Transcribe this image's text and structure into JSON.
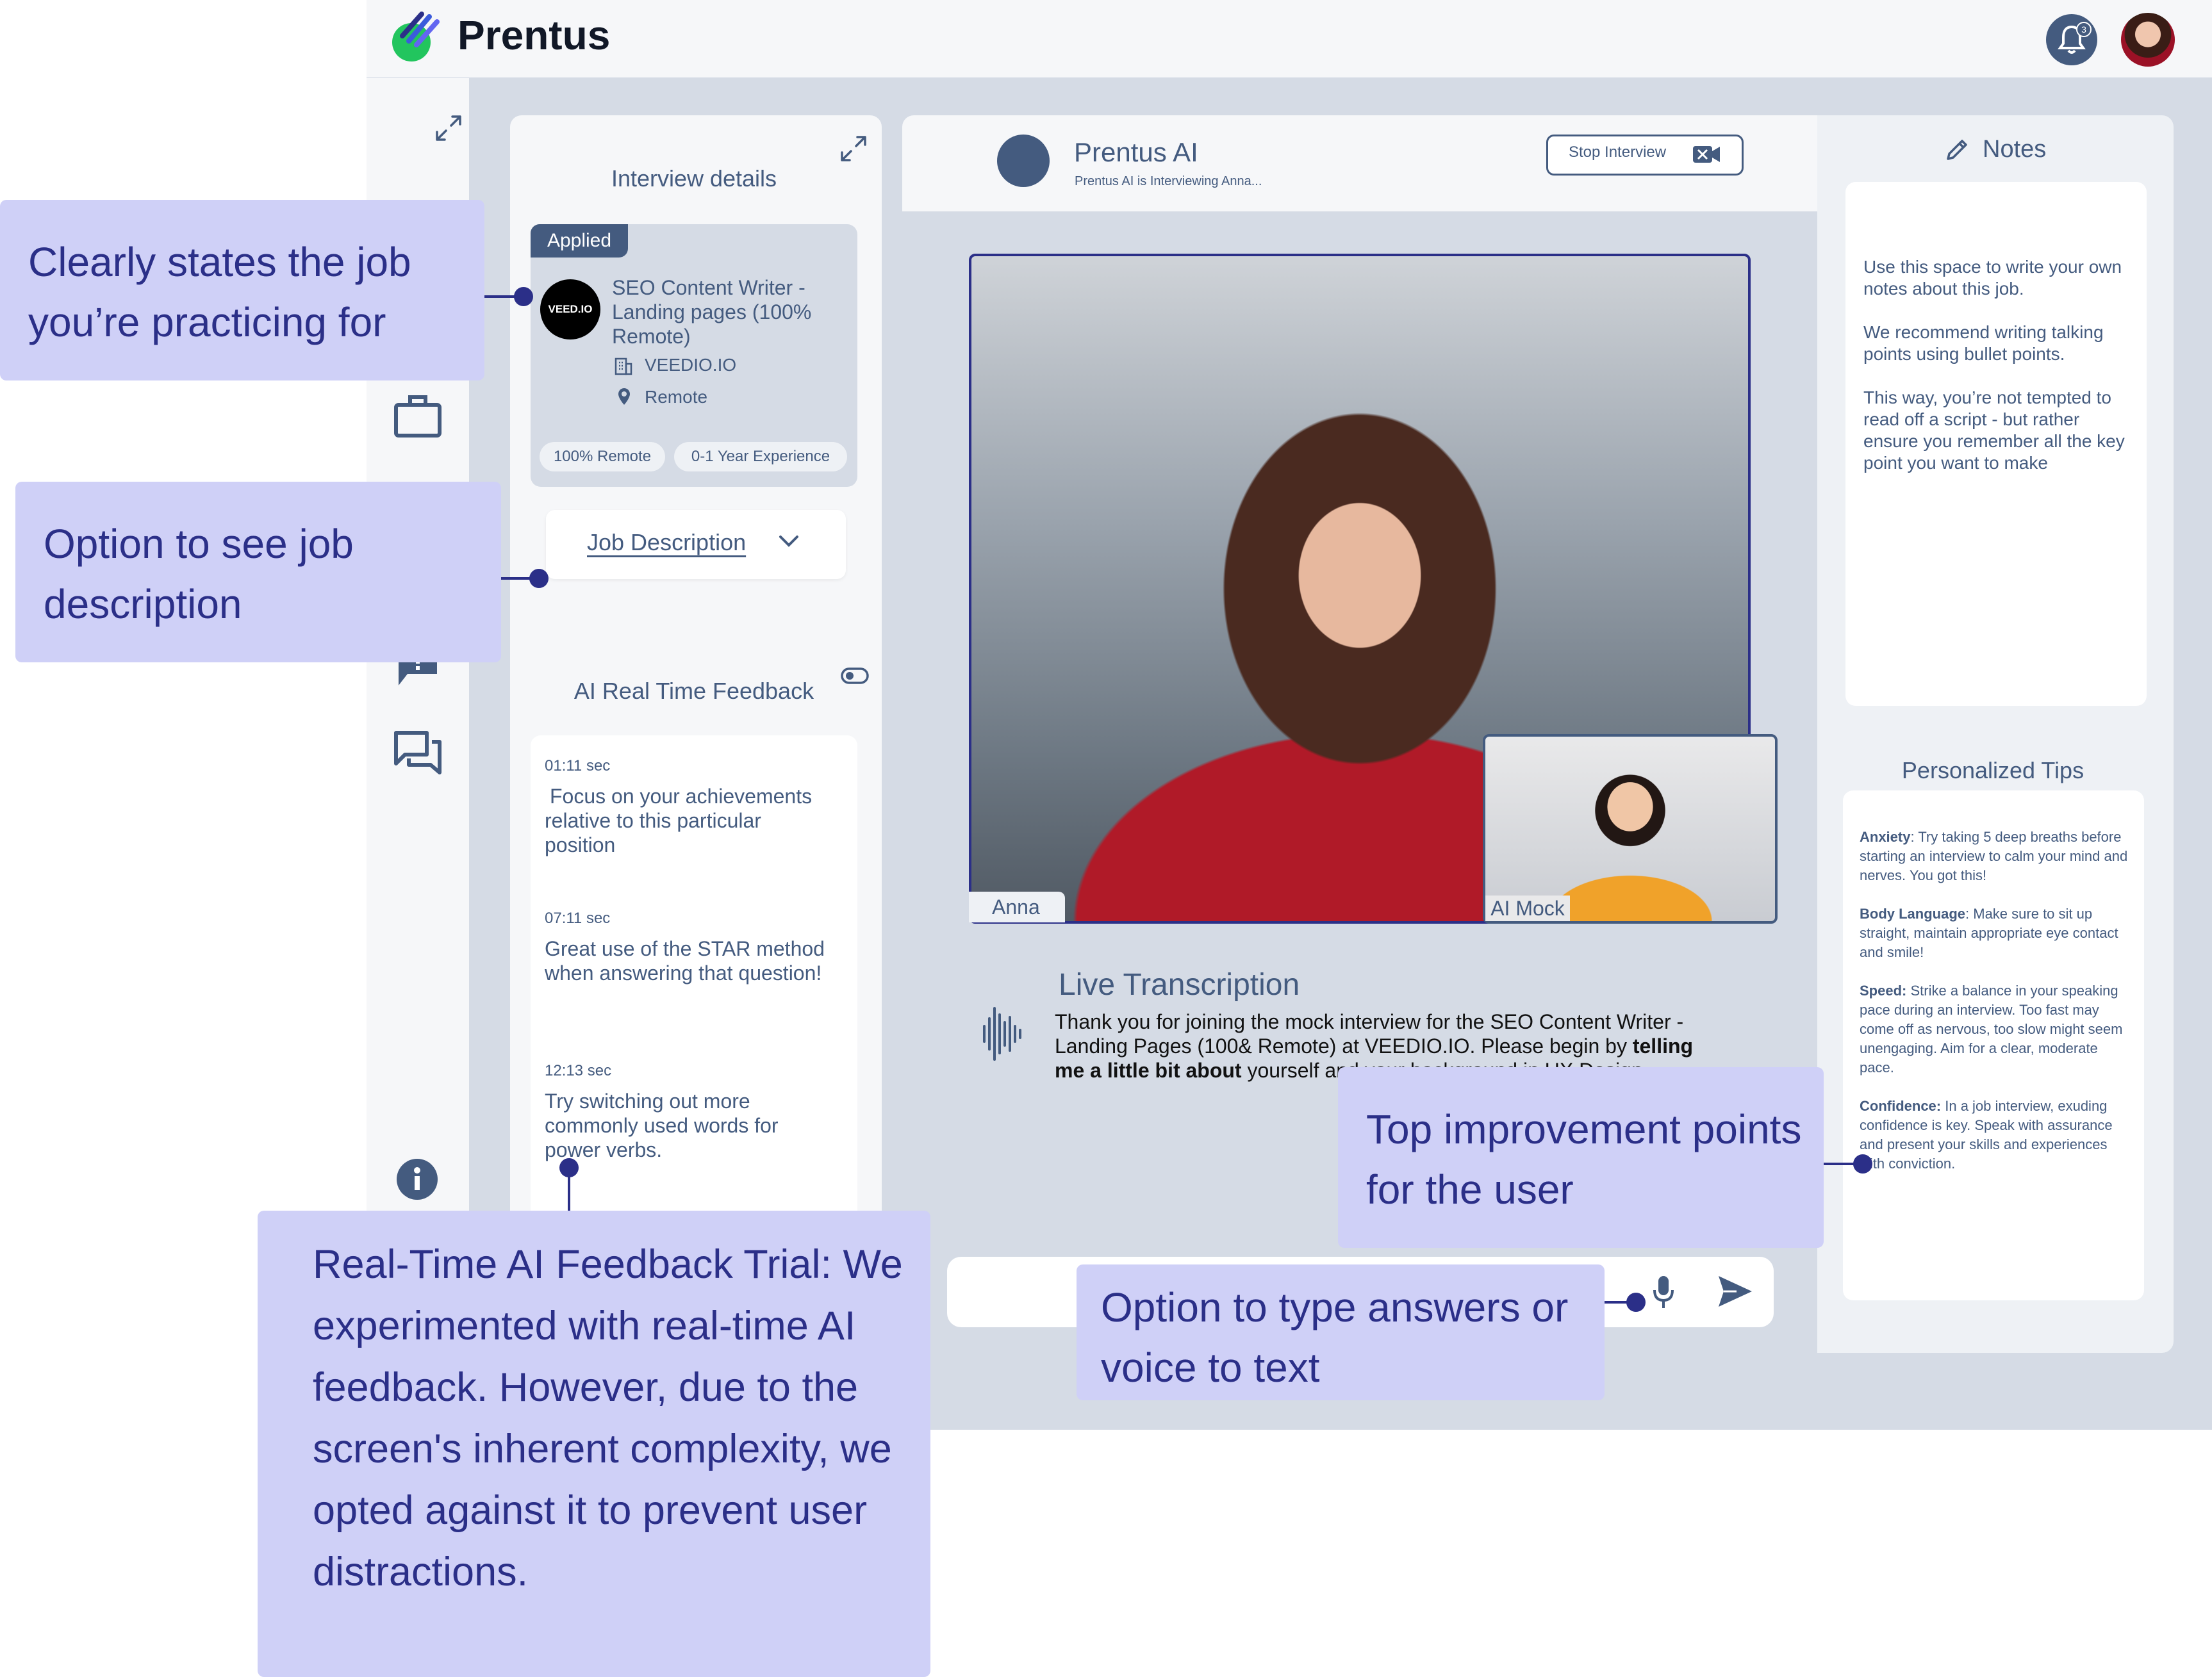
{
  "app": {
    "name": "Prentus",
    "notification_count": "3"
  },
  "colors": {
    "primary": "#445b7f",
    "callout_bg": "#cfd0f7",
    "callout_text": "#2b2f88",
    "brand_green": "#22c55e"
  },
  "details": {
    "title": "Interview details",
    "status_badge": "Applied",
    "company_logo_text": "VEED.IO",
    "job_title": "SEO Content Writer - Landing pages (100% Remote)",
    "company": "VEEDIO.IO",
    "location": "Remote",
    "tags": [
      "100% Remote",
      "0-1 Year Experience"
    ],
    "job_description_button": "Job Description"
  },
  "feedback": {
    "title": "AI Real Time Feedback",
    "items": [
      {
        "time": "01:11 sec",
        "text": "Focus on your achievements relative to this particular position"
      },
      {
        "time": "07:11 sec",
        "text": "Great use of the STAR method when answering that question!"
      },
      {
        "time": "12:13 sec",
        "text": "Try switching out more commonly used words for power verbs."
      }
    ]
  },
  "interview": {
    "ai_name": "Prentus AI",
    "ai_subtitle": "Prentus AI is Interviewing Anna...",
    "stop_button": "Stop Interview",
    "main_video_label": "Anna",
    "pip_video_label": "AI Mock",
    "live_title": "Live Transcription",
    "transcript_part1": "Thank you for joining the mock interview for the SEO Content Writer - Landing Pages (100& Remote) at VEEDIO.IO. Please begin by ",
    "transcript_bold": "telling me a little bit about",
    "transcript_part2": " yourself and your background in UX Design."
  },
  "notes": {
    "title": "Notes",
    "paragraphs": [
      "Use this space to write your own notes about this job.",
      "We recommend writing talking points using bullet points.",
      "This way, you’re not tempted to read off a script - but rather ensure you remember all the key point you want to make"
    ]
  },
  "tips": {
    "title": "Personalized Tips",
    "items": [
      {
        "label": "Anxiety",
        "sep": ": ",
        "text": "Try taking 5 deep breaths before starting an interview to calm your mind and nerves. You got this!"
      },
      {
        "label": "Body Language",
        "sep": ": ",
        "text": "Make sure to sit up straight, maintain appropriate eye contact and smile!"
      },
      {
        "label": "Speed:",
        "sep": " ",
        "text": "Strike a balance in your speaking pace during an interview. Too fast may come off as nervous, too slow might seem unengaging. Aim for a clear, moderate pace."
      },
      {
        "label": "Confidence:",
        "sep": " ",
        "text": "In a job interview, exuding confidence is key. Speak with assurance and present your skills and experiences with conviction."
      }
    ]
  },
  "callouts": {
    "job": "Clearly states the job you’re practicing for",
    "description": "Option to see job description",
    "feedback": "Real-Time AI Feedback Trial: We experimented with real-time AI feedback. However, due to the screen's inherent complexity, we opted against it to prevent user distractions.",
    "improvement": "Top improvement points for the user",
    "input": "Option to type answers or voice to text"
  },
  "icons": [
    "logo-mark-icon",
    "bell-icon",
    "expand-icon",
    "briefcase-icon",
    "chat-alert-icon",
    "chat-icon",
    "info-icon",
    "building-icon",
    "location-pin-icon",
    "chevron-down-icon",
    "toggle-icon",
    "video-off-icon",
    "pencil-icon",
    "soundwave-icon",
    "microphone-icon",
    "send-icon"
  ]
}
